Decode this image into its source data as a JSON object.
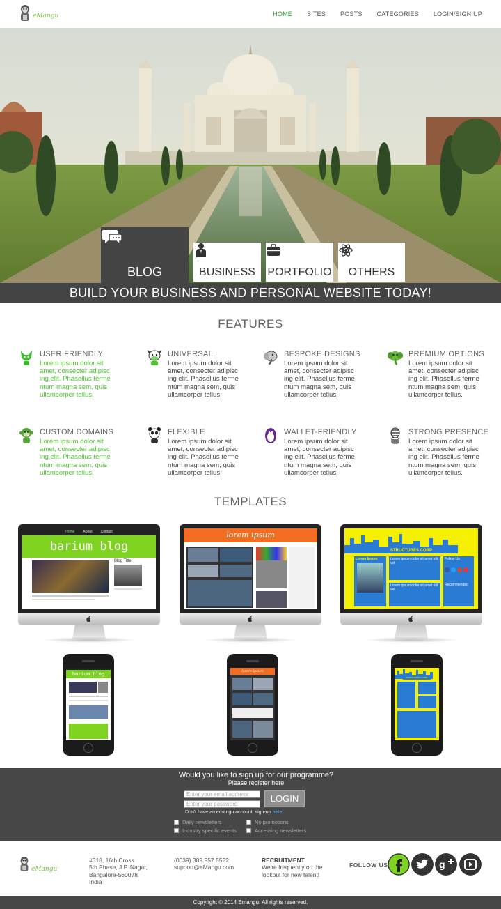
{
  "header": {
    "logo_text": "eMangu",
    "nav": [
      "HOME",
      "SITES",
      "POSTS",
      "CATEGORIES",
      "LOGIN/SIGN UP"
    ]
  },
  "hero": {
    "tabs": [
      {
        "label": "BLOG",
        "icon": "chat-bubble-icon",
        "active": true
      },
      {
        "label": "BUSINESS",
        "icon": "person-icon",
        "active": false
      },
      {
        "label": "PORTFOLIO",
        "icon": "briefcase-icon",
        "active": false
      },
      {
        "label": "OTHERS",
        "icon": "atom-icon",
        "active": false
      }
    ],
    "banner": "BUILD YOUR BUSINESS AND PERSONAL WEBSITE TODAY!"
  },
  "features": {
    "title": "FEATURES",
    "items": [
      {
        "title": "USER FRIENDLY",
        "desc": "Lorem ipsum dolor sit amet, consecter adipisc ing elit. Phasellus ferme ntum magna sem, quis ullamcorper tellus.",
        "icon": "fox-mascot-icon"
      },
      {
        "title": "UNIVERSAL",
        "desc": "Lorem ipsum dolor sit amet, consecter adipisc ing elit. Phasellus ferme ntum magna sem, quis ullamcorper tellus.",
        "icon": "cow-mascot-icon"
      },
      {
        "title": "BESPOKE DESIGNS",
        "desc": "Lorem ipsum dolor sit amet, consecter adipisc ing elit. Phasellus ferme ntum magna sem, quis ullamcorper tellus.",
        "icon": "elephant-mascot-icon"
      },
      {
        "title": "PREMIUM OPTIONS",
        "desc": "Lorem ipsum dolor sit amet, consecter adipisc ing elit. Phasellus ferme ntum magna sem, quis ullamcorper tellus.",
        "icon": "green-elephant-mascot-icon"
      },
      {
        "title": "CUSTOM DOMAINS",
        "desc": "Lorem ipsum dolor sit amet, consecter adipisc ing elit. Phasellus ferme ntum magna sem, quis ullamcorper tellus.",
        "icon": "monkey-mascot-icon"
      },
      {
        "title": "FLEXIBLE",
        "desc": "Lorem ipsum dolor sit amet, consecter adipisc ing elit. Phasellus ferme ntum magna sem, quis ullamcorper tellus.",
        "icon": "panda-mascot-icon"
      },
      {
        "title": "WALLET-FRIENDLY",
        "desc": "Lorem ipsum dolor sit amet, consecter adipisc ing elit. Phasellus ferme ntum magna sem, quis ullamcorper tellus.",
        "icon": "penguin-mascot-icon"
      },
      {
        "title": "STRONG PRESENCE",
        "desc": "Lorem ipsum dolor sit amet, consecter adipisc ing elit. Phasellus ferme ntum magna sem, quis ullamcorper tellus.",
        "icon": "zebra-mascot-icon"
      }
    ]
  },
  "templates": {
    "title": "TEMPLATES",
    "desktop": [
      {
        "name": "barium blog",
        "nav": [
          "Home",
          "About",
          "Contact"
        ],
        "headline": "Blog Title"
      },
      {
        "name": "lorem ipsum"
      },
      {
        "name": "STRUCTURES CORP",
        "panels": [
          "Lorem Ipsum",
          "Lorem ipsum dolor sit amet elit vel",
          "Lorem ipsum dolor sit amet elit vel",
          "Follow Us",
          "Recommended"
        ]
      }
    ],
    "mobile": [
      {
        "name": "barium blog"
      },
      {
        "name": "lorem ipsum"
      },
      {
        "name": "STRUCTURES CORP"
      }
    ]
  },
  "signup": {
    "question": "Would you like to sign up for our programme?",
    "sub": "Please register here",
    "email_placeholder": "Enter your email address",
    "password_placeholder": "Enter your password",
    "login": "LOGIN",
    "no_account": "Don't have an emangu account, sign-up",
    "here": "here",
    "checkboxes": [
      "Daily newsletters",
      "No promotions",
      "Industry specific events",
      "Accessing newsletters"
    ]
  },
  "footer": {
    "logo_text": "eMangu",
    "address": [
      "#318, 16th Cross",
      "5th Phase, J.P. Nagar,",
      "Bangalore-560078",
      "India"
    ],
    "contact": [
      "(0039) 389 957 5522",
      "support@eMangu.com"
    ],
    "recruitment_title": "RECRUITMENT",
    "recruitment_text": [
      "We're frequently on the",
      "lookout for new talent!"
    ],
    "follow": "FOLLOW US",
    "social": [
      "facebook-icon",
      "twitter-icon",
      "google-plus-icon",
      "youtube-icon"
    ],
    "copyright": "Copyright  © 2014  Emangu. All rights reserved."
  },
  "colors": {
    "accent_green": "#4cc82c",
    "dark": "#444444",
    "nav_active": "#2c9a2c"
  }
}
